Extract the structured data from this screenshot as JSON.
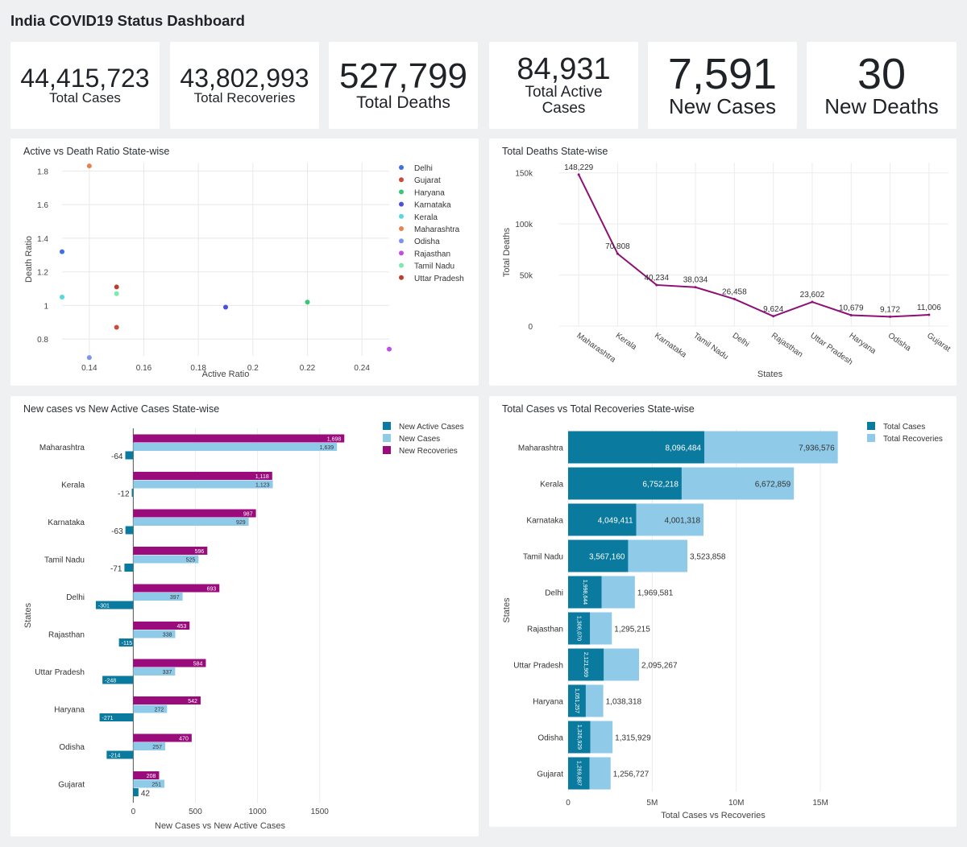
{
  "page_title": "India COVID19 Status Dashboard",
  "kpis": [
    {
      "value": "44,415,723",
      "label": "Total Cases"
    },
    {
      "value": "43,802,993",
      "label": "Total Recoveries"
    },
    {
      "value": "527,799",
      "label": "Total Deaths"
    },
    {
      "value": "84,931",
      "label": "Total Active Cases"
    },
    {
      "value": "7,591",
      "label": "New Cases"
    },
    {
      "value": "30",
      "label": "New Deaths"
    }
  ],
  "chart_data": [
    {
      "type": "scatter",
      "title": "Active vs Death Ratio State-wise",
      "xlabel": "Active Ratio",
      "ylabel": "Death Ratio",
      "xlim": [
        0.13,
        0.25
      ],
      "ylim": [
        0.7,
        1.85
      ],
      "xticks": [
        "0.14",
        "0.16",
        "0.18",
        "0.2",
        "0.22",
        "0.24"
      ],
      "yticks": [
        "0.8",
        "1",
        "1.2",
        "1.4",
        "1.6",
        "1.8"
      ],
      "legend_position": "right",
      "series": [
        {
          "name": "Delhi",
          "color": "#3f6fe6",
          "x": 0.13,
          "y": 1.32
        },
        {
          "name": "Gujarat",
          "color": "#cb4b3a",
          "x": 0.15,
          "y": 0.87
        },
        {
          "name": "Haryana",
          "color": "#39c777",
          "x": 0.22,
          "y": 1.02
        },
        {
          "name": "Karnataka",
          "color": "#4a4fe0",
          "x": 0.19,
          "y": 0.99
        },
        {
          "name": "Kerala",
          "color": "#56d8df",
          "x": 0.13,
          "y": 1.05
        },
        {
          "name": "Maharashtra",
          "color": "#e88350",
          "x": 0.14,
          "y": 1.83
        },
        {
          "name": "Odisha",
          "color": "#7b95ee",
          "x": 0.14,
          "y": 0.69
        },
        {
          "name": "Rajasthan",
          "color": "#c04ee6",
          "x": 0.25,
          "y": 0.74
        },
        {
          "name": "Tamil Nadu",
          "color": "#78ecac",
          "x": 0.15,
          "y": 1.07
        },
        {
          "name": "Uttar Pradesh",
          "color": "#b9402c",
          "x": 0.15,
          "y": 1.11
        }
      ]
    },
    {
      "type": "line",
      "title": "Total Deaths State-wise",
      "xlabel": "States",
      "ylabel": "Total Deaths",
      "color": "#8c1077",
      "ylim": [
        0,
        160000
      ],
      "yticks": [
        {
          "v": 0,
          "label": "0"
        },
        {
          "v": 50000,
          "label": "50k"
        },
        {
          "v": 100000,
          "label": "100k"
        },
        {
          "v": 150000,
          "label": "150k"
        }
      ],
      "categories": [
        "Maharashtra",
        "Kerala",
        "Karnataka",
        "Tamil Nadu",
        "Delhi",
        "Rajasthan",
        "Uttar Pradesh",
        "Haryana",
        "Odisha",
        "Gujarat"
      ],
      "values": [
        148229,
        70808,
        40234,
        38034,
        26458,
        9624,
        23602,
        10679,
        9172,
        11006
      ],
      "value_labels": [
        "148,229",
        "70,808",
        "40,234",
        "38,034",
        "26,458",
        "9,624",
        "23,602",
        "10,679",
        "9,172",
        "11,006"
      ]
    },
    {
      "type": "bar",
      "orientation": "horizontal",
      "title": "New cases vs New Active Cases State-wise",
      "xlabel": "New Cases vs New Active Cases",
      "ylabel": "States",
      "xlim": [
        -320,
        1800
      ],
      "xticks": [
        {
          "v": 0,
          "label": "0"
        },
        {
          "v": 500,
          "label": "500"
        },
        {
          "v": 1000,
          "label": "1000"
        },
        {
          "v": 1500,
          "label": "1500"
        }
      ],
      "legend_position": "top-right",
      "categories": [
        "Maharashtra",
        "Kerala",
        "Karnataka",
        "Tamil Nadu",
        "Delhi",
        "Rajasthan",
        "Uttar Pradesh",
        "Haryana",
        "Odisha",
        "Gujarat"
      ],
      "series": [
        {
          "name": "New Active Cases",
          "color": "#0a7a9e",
          "values": [
            -64,
            -12,
            -63,
            -71,
            -301,
            -115,
            -248,
            -271,
            -214,
            42
          ],
          "labels": [
            "-64",
            "-12",
            "-63",
            "-71",
            "-301",
            "-115",
            "-248",
            "-271",
            "-214",
            "42"
          ],
          "label_inside": [
            false,
            false,
            false,
            false,
            true,
            true,
            true,
            true,
            true,
            false
          ]
        },
        {
          "name": "New Cases",
          "color": "#8fcbe8",
          "values": [
            1639,
            1123,
            929,
            525,
            397,
            338,
            337,
            272,
            257,
            251
          ],
          "labels": [
            "1,639",
            "1,123",
            "929",
            "525",
            "397",
            "338",
            "337",
            "272",
            "257",
            "251"
          ]
        },
        {
          "name": "New Recoveries",
          "color": "#9a0b7c",
          "values": [
            1698,
            1118,
            987,
            596,
            693,
            453,
            584,
            542,
            470,
            208
          ],
          "labels": [
            "1,698",
            "1,118",
            "987",
            "596",
            "693",
            "453",
            "584",
            "542",
            "470",
            "208"
          ]
        }
      ]
    },
    {
      "type": "bar",
      "orientation": "horizontal",
      "stacked": true,
      "title": "Total Cases vs Total Recoveries State-wise",
      "xlabel": "Total Cases vs Recoveries",
      "ylabel": "States",
      "xlim": [
        0,
        17200000
      ],
      "xticks": [
        {
          "v": 0,
          "label": "0"
        },
        {
          "v": 5000000,
          "label": "5M"
        },
        {
          "v": 10000000,
          "label": "10M"
        },
        {
          "v": 15000000,
          "label": "15M"
        }
      ],
      "legend_position": "top-right",
      "categories": [
        "Maharashtra",
        "Kerala",
        "Karnataka",
        "Tamil Nadu",
        "Delhi",
        "Rajasthan",
        "Uttar Pradesh",
        "Haryana",
        "Odisha",
        "Gujarat"
      ],
      "series": [
        {
          "name": "Total Cases",
          "color": "#0a7a9e",
          "values": [
            8096484,
            6752218,
            4049411,
            3567160,
            1998644,
            1306070,
            2121969,
            1051257,
            1326929,
            1269887
          ],
          "labels": [
            "8,096,484",
            "6,752,218",
            "4,049,411",
            "3,567,160",
            "1,998,644",
            "1,306,070",
            "2,121,969",
            "1,051,257",
            "1,326,929",
            "1,269,887"
          ]
        },
        {
          "name": "Total Recoveries",
          "color": "#8fcbe8",
          "values": [
            7936576,
            6672859,
            4001318,
            3523858,
            1969581,
            1295215,
            2095267,
            1038318,
            1315929,
            1256727
          ],
          "labels": [
            "7,936,576",
            "6,672,859",
            "4,001,318",
            "3,523,858",
            "1,969,581",
            "1,295,215",
            "2,095,267",
            "1,038,318",
            "1,315,929",
            "1,256,727"
          ]
        }
      ]
    }
  ]
}
